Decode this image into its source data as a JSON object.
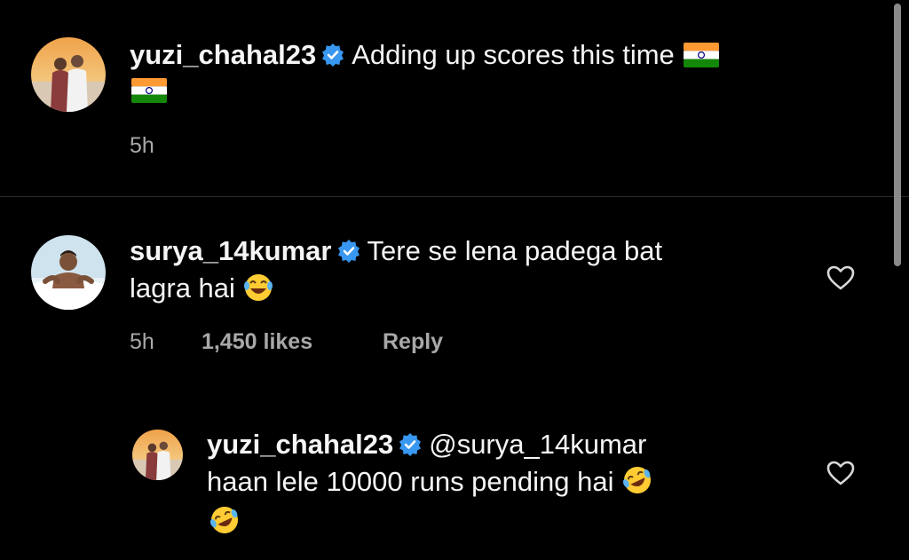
{
  "post": {
    "username": "yuzi_chahal23",
    "caption": "Adding up scores this time",
    "time": "5h",
    "avatar": "avatar-couple-beach"
  },
  "comments": [
    {
      "username": "surya_14kumar",
      "text_line1": "Tere se lena padega bat",
      "text_line2": "lagra hai",
      "emoji": "face-with-tears-of-joy",
      "time": "5h",
      "likes": "1,450 likes",
      "reply_label": "Reply",
      "avatar": "avatar-man-pool",
      "replies": [
        {
          "username": "yuzi_chahal23",
          "mention": "@surya_14kumar",
          "text_line2": "haan lele 10000 runs pending hai",
          "emoji": "rolling-on-the-floor-laughing",
          "avatar": "avatar-couple-beach"
        }
      ]
    }
  ],
  "colors": {
    "background": "#000000",
    "text": "#f5f5f5",
    "meta": "#a8a8a8",
    "verified": "#3897f0"
  },
  "icons": [
    "verified-badge-icon",
    "heart-icon",
    "india-flag-icon",
    "laughing-emoji-icon"
  ]
}
